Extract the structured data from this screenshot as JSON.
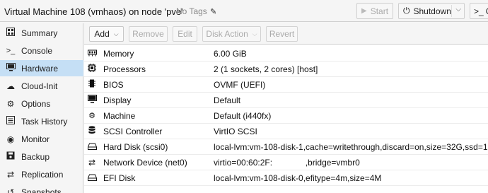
{
  "header": {
    "vm_title": "Virtual Machine 108 (vmhaos) on node 'pve'",
    "tags_label": "No Tags",
    "start_label": "Start",
    "shutdown_label": "Shutdown",
    "console_label": "C"
  },
  "sidebar": {
    "items": [
      {
        "label": "Summary",
        "icon": "summary-icon"
      },
      {
        "label": "Console",
        "icon": "terminal-icon"
      },
      {
        "label": "Hardware",
        "icon": "monitor-icon",
        "active": true
      },
      {
        "label": "Cloud-Init",
        "icon": "cloud-icon"
      },
      {
        "label": "Options",
        "icon": "gear-icon"
      },
      {
        "label": "Task History",
        "icon": "list-icon"
      },
      {
        "label": "Monitor",
        "icon": "eye-icon"
      },
      {
        "label": "Backup",
        "icon": "floppy-icon"
      },
      {
        "label": "Replication",
        "icon": "replication-icon"
      },
      {
        "label": "Snapshots",
        "icon": "history-icon"
      }
    ]
  },
  "toolbar": {
    "add_label": "Add",
    "remove_label": "Remove",
    "edit_label": "Edit",
    "disk_action_label": "Disk Action",
    "revert_label": "Revert"
  },
  "hardware": {
    "rows": [
      {
        "name": "Memory",
        "value": "6.00 GiB",
        "icon": "memory-icon"
      },
      {
        "name": "Processors",
        "value": "2 (1 sockets, 2 cores) [host]",
        "icon": "cpu-icon"
      },
      {
        "name": "BIOS",
        "value": "OVMF (UEFI)",
        "icon": "microchip-icon"
      },
      {
        "name": "Display",
        "value": "Default",
        "icon": "desktop-icon"
      },
      {
        "name": "Machine",
        "value": "Default (i440fx)",
        "icon": "cogs-icon"
      },
      {
        "name": "SCSI Controller",
        "value": "VirtIO SCSI",
        "icon": "database-icon"
      },
      {
        "name": "Hard Disk (scsi0)",
        "value": "local-lvm:vm-108-disk-1,cache=writethrough,discard=on,size=32G,ssd=1",
        "icon": "hdd-icon"
      },
      {
        "name": "Network Device (net0)",
        "value": "virtio=00:60:2F:              ,bridge=vmbr0",
        "icon": "exchange-icon"
      },
      {
        "name": "EFI Disk",
        "value": "local-lvm:vm-108-disk-0,efitype=4m,size=4M",
        "icon": "hdd-icon"
      }
    ]
  },
  "colors": {
    "active_nav_bg": "#c5dff5",
    "panel_bg": "#f5f5f5"
  }
}
